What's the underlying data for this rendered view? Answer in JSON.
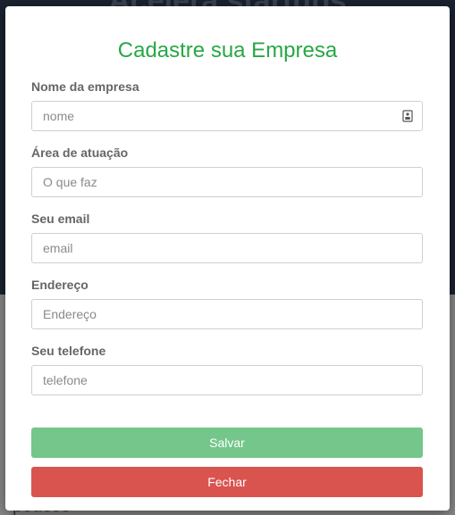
{
  "backdrop": {
    "heading": "Acelera startups",
    "bottom_text": "poucos"
  },
  "modal": {
    "title": "Cadastre sua Empresa",
    "fields": [
      {
        "label": "Nome da empresa",
        "placeholder": "nome"
      },
      {
        "label": "Área de atuação",
        "placeholder": "O que faz"
      },
      {
        "label": "Seu email",
        "placeholder": "email"
      },
      {
        "label": "Endereço",
        "placeholder": "Endereço"
      },
      {
        "label": "Seu telefone",
        "placeholder": "telefone"
      }
    ],
    "save_label": "Salvar",
    "close_label": "Fechar"
  },
  "colors": {
    "title": "#28a745",
    "save_button": "#74c68a",
    "close_button": "#d9534f"
  },
  "icons": {
    "company_field": "id-card-icon"
  }
}
